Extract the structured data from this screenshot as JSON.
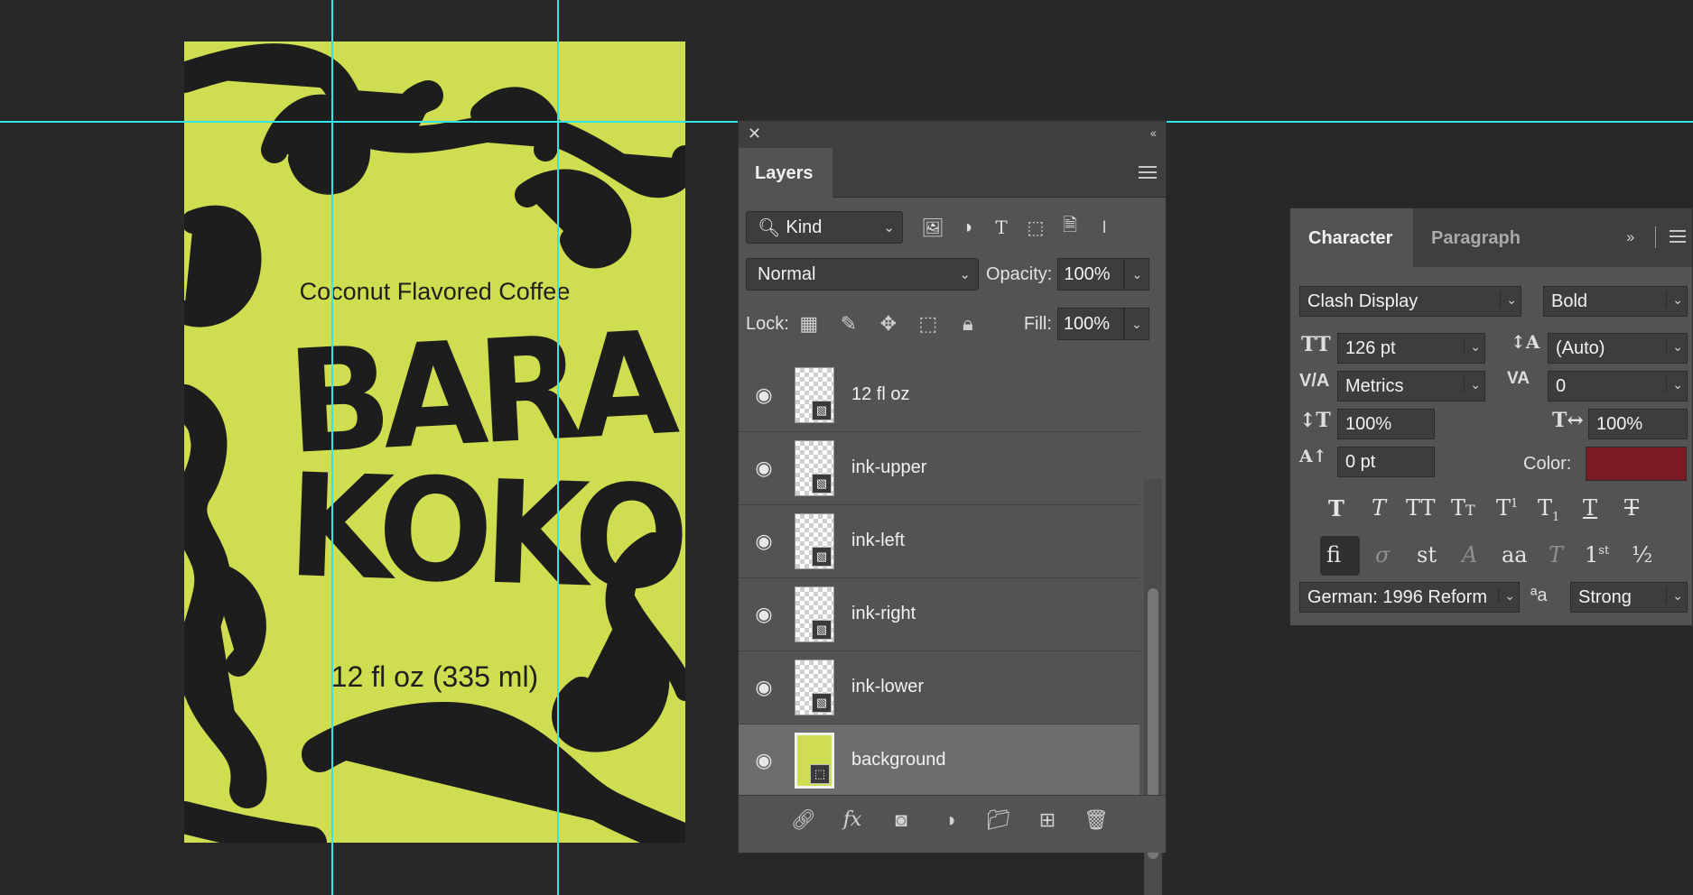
{
  "artwork": {
    "tagline": "Coconut Flavored Coffee",
    "brand_line1": "BARA",
    "brand_line2": "KOKO",
    "volume": "12 fl oz (335 ml)"
  },
  "layers_panel": {
    "close_icon": "✕",
    "collapse_icon": "‹‹",
    "tab_label": "Layers",
    "filter_kind": "Kind",
    "blend_mode": "Normal",
    "opacity_label": "Opacity:",
    "opacity_value": "100%",
    "lock_label": "Lock:",
    "fill_label": "Fill:",
    "fill_value": "100%",
    "layers": [
      {
        "name": "12 fl oz"
      },
      {
        "name": "ink-upper"
      },
      {
        "name": "ink-left"
      },
      {
        "name": "ink-right"
      },
      {
        "name": "ink-lower"
      },
      {
        "name": "background",
        "selected": true
      }
    ]
  },
  "character_panel": {
    "tab_character": "Character",
    "tab_paragraph": "Paragraph",
    "font_family": "Clash Display",
    "font_style": "Bold",
    "font_size": "126 pt",
    "leading": "(Auto)",
    "kerning": "Metrics",
    "tracking": "0",
    "vertical_scale": "100%",
    "horizontal_scale": "100%",
    "baseline_shift": "0 pt",
    "color_label": "Color:",
    "color_value": "#7a1a22",
    "language": "German: 1996 Reform",
    "antialias": "Strong",
    "antialias_icon": "ªa"
  },
  "colors": {
    "label_background": "#cfdd50",
    "ink": "#1d1d1d",
    "guides": "#2fe6ea",
    "app_background": "#282828",
    "panel": "#535353"
  }
}
